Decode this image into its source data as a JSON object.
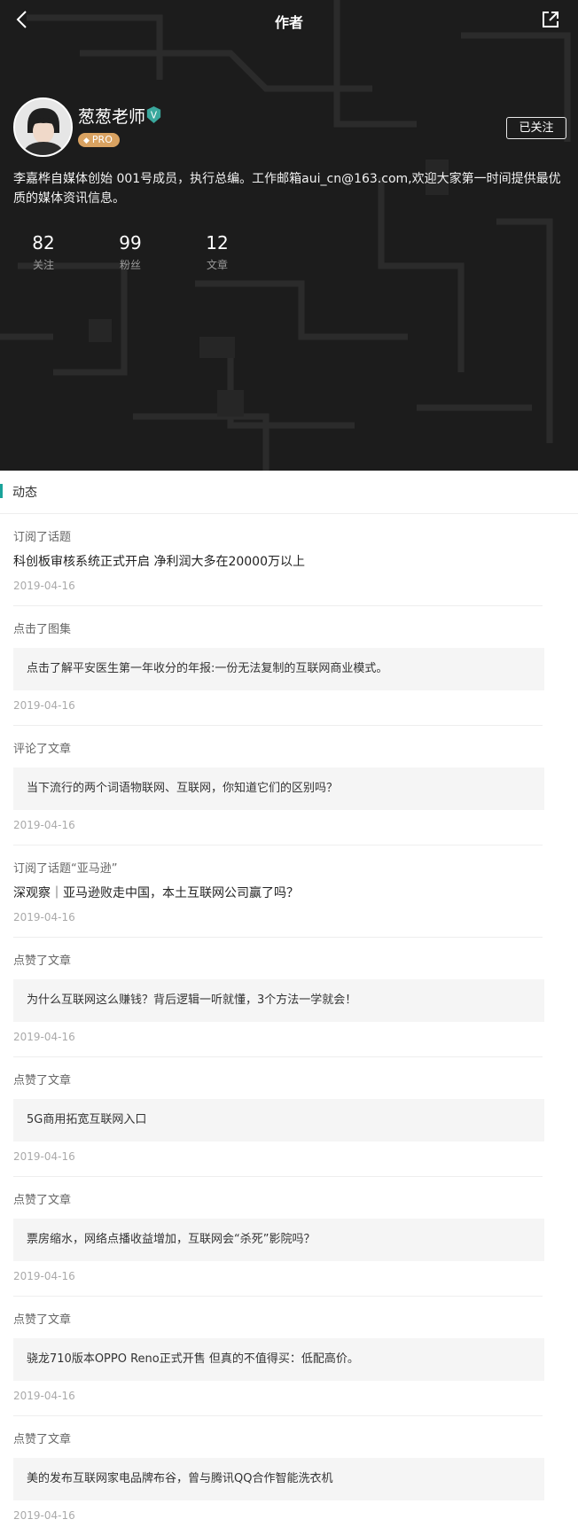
{
  "topbar": {
    "title": "作者"
  },
  "profile": {
    "name": "葱葱老师",
    "pro_label": "PRO",
    "follow_label": "已关注",
    "bio": "李嘉桦自媒体创始 001号成员，执行总编。工作邮箱aui_cn@163.com,欢迎大家第一时间提供最优质的媒体资讯信息。",
    "stats": [
      {
        "value": "82",
        "label": "关注"
      },
      {
        "value": "99",
        "label": "粉丝"
      },
      {
        "value": "12",
        "label": "文章"
      }
    ]
  },
  "section": {
    "title": "动态"
  },
  "feed": [
    {
      "action": "订阅了话题",
      "content": "科创板审核系统正式开启 净利润大多在20000万以上",
      "boxed": false,
      "date": "2019-04-16"
    },
    {
      "action": "点击了图集",
      "content": "点击了解平安医生第一年收分的年报:一份无法复制的互联网商业模式。",
      "boxed": true,
      "date": "2019-04-16"
    },
    {
      "action": "评论了文章",
      "content": "当下流行的两个词语物联网、互联网，你知道它们的区别吗？",
      "boxed": true,
      "date": "2019-04-16"
    },
    {
      "action": "订阅了话题“亚马逊”",
      "content": "深观察｜亚马逊败走中国，本土互联网公司赢了吗？",
      "boxed": false,
      "date": "2019-04-16"
    },
    {
      "action": "点赞了文章",
      "content": "为什么互联网这么赚钱？背后逻辑一听就懂，3个方法一学就会！",
      "boxed": true,
      "date": "2019-04-16"
    },
    {
      "action": "点赞了文章",
      "content": "5G商用拓宽互联网入口",
      "boxed": true,
      "date": "2019-04-16"
    },
    {
      "action": "点赞了文章",
      "content": "票房缩水，网络点播收益增加，互联网会“杀死”影院吗？",
      "boxed": true,
      "date": "2019-04-16"
    },
    {
      "action": "点赞了文章",
      "content": "骁龙710版本OPPO Reno正式开售 但真的不值得买：低配高价。",
      "boxed": true,
      "date": "2019-04-16"
    },
    {
      "action": "点赞了文章",
      "content": "美的发布互联网家电品牌布谷，曾与腾讯QQ合作智能洗衣机",
      "boxed": true,
      "date": "2019-04-16"
    }
  ],
  "colors": {
    "header_bg": "#1c1c1c",
    "accent": "#1aa39a",
    "pro_badge": "#d9a261"
  },
  "icons": {
    "back": "back-arrow-icon",
    "share": "share-external-icon",
    "verified": "verified-v-icon",
    "pro": "diamond-icon"
  }
}
